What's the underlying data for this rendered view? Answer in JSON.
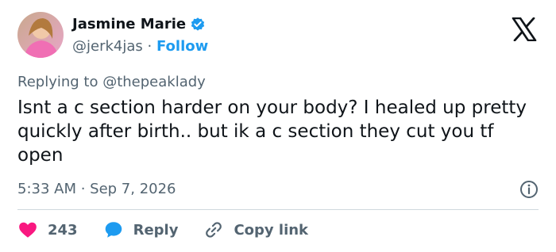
{
  "tweet": {
    "author": {
      "name": "Jasmine Marie",
      "handle": "@jerk4jas",
      "separator": "·",
      "follow_label": "Follow",
      "verified": true
    },
    "replying_prefix": "Replying to",
    "replying_to": "@thepeaklady",
    "text": "Isnt a c section harder on your body? I healed up pretty quickly after birth.. but ik a c section they cut you tf open",
    "timestamp": "5:33 AM · Sep 7, 2026"
  },
  "actions": {
    "likes": "243",
    "reply_label": "Reply",
    "copy_label": "Copy link"
  },
  "colors": {
    "accent": "#1d9bf0",
    "like": "#f91880",
    "text": "#0f1419",
    "muted": "#536471"
  },
  "icons": [
    "verified-badge-icon",
    "x-logo-icon",
    "info-icon",
    "heart-icon",
    "reply-bubble-icon",
    "link-icon"
  ]
}
